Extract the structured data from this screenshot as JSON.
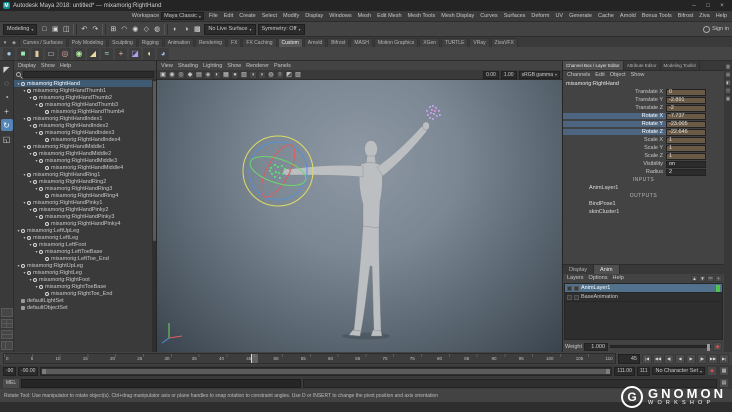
{
  "colors": {
    "selection_highlight": "#3f5a73",
    "keyed_channel": "#6b5a46",
    "active_tool_blue": "#5285b5",
    "manip_x_red": "#e05c5c",
    "manip_y_green": "#6cd66c",
    "manip_z_blue": "#5590d6",
    "manip_outer_yellow": "#dede66",
    "selected_joints_green": "#63e07c",
    "secondary_joints_purple": "#c7a4ea",
    "anim_layer_indicator_green": "#4ec24e"
  },
  "icons": {
    "chevron_down": "▾",
    "window_minimize": "–",
    "window_maximize": "□",
    "window_close": "×",
    "maya_logo_letter": "M",
    "autokey": "◆",
    "prefs_gear": "▦",
    "script_editor": "▤",
    "weight_key": "◆"
  },
  "title_bar": {
    "title": "Autodesk Maya 2018: untitled* --- mixamorig:RightHand"
  },
  "menu_bar": {
    "items": [
      "File",
      "Edit",
      "Create",
      "Select",
      "Modify",
      "Display",
      "Windows",
      "Mesh",
      "Edit Mesh",
      "Mesh Tools",
      "Mesh Display",
      "Curves",
      "Surfaces",
      "Deform",
      "UV",
      "Generate",
      "Cache",
      "Arnold",
      "Bonus Tools",
      "Bifrost",
      "Ziva",
      "Help"
    ],
    "workspace_label": "Workspace",
    "workspace_value": "Maya Classic"
  },
  "status_line": {
    "menu_set": "Modeling",
    "icons": [
      {
        "name": "new-scene-icon",
        "glyph": "□"
      },
      {
        "name": "open-scene-icon",
        "glyph": "▣"
      },
      {
        "name": "save-scene-icon",
        "glyph": "◫"
      },
      {
        "name": "separator",
        "cls": "sep",
        "glyph": ""
      },
      {
        "name": "undo-icon",
        "glyph": "↶"
      },
      {
        "name": "redo-icon",
        "glyph": "↷"
      },
      {
        "name": "separator",
        "cls": "sep",
        "glyph": ""
      },
      {
        "name": "snap-to-grid-icon",
        "glyph": "⊞"
      },
      {
        "name": "snap-to-curve-icon",
        "glyph": "◠"
      },
      {
        "name": "snap-to-point-icon",
        "glyph": "◉"
      },
      {
        "name": "snap-to-plane-icon",
        "glyph": "◇"
      },
      {
        "name": "make-live-icon",
        "glyph": "◍"
      },
      {
        "name": "separator",
        "cls": "sep",
        "glyph": ""
      },
      {
        "name": "render-icon",
        "glyph": "◐"
      },
      {
        "name": "ipr-render-icon",
        "glyph": "◑"
      },
      {
        "name": "render-settings-icon",
        "glyph": "▩"
      }
    ],
    "no_live_surface": "No Live Surface",
    "symmetry": "Symmetry: Off",
    "sign_in": "Sign in"
  },
  "shelf": {
    "tabs": [
      {
        "label": "Curves / Surfaces"
      },
      {
        "label": "Poly Modeling"
      },
      {
        "label": "Sculpting"
      },
      {
        "label": "Rigging"
      },
      {
        "label": "Animation"
      },
      {
        "label": "Rendering"
      },
      {
        "label": "FX"
      },
      {
        "label": "FX Caching"
      },
      {
        "label": "Custom",
        "cls": "active"
      },
      {
        "label": "Arnold"
      },
      {
        "label": "Bifrost"
      },
      {
        "label": "MASH"
      },
      {
        "label": "Motion Graphics"
      },
      {
        "label": "XGen"
      },
      {
        "label": "TURTLE"
      },
      {
        "label": "VRay"
      },
      {
        "label": "ZivaVFX"
      }
    ],
    "icons": [
      {
        "name": "shelf-sphere-icon",
        "glyph": "●",
        "color": "#9ec7e8"
      },
      {
        "name": "shelf-cube-icon",
        "glyph": "■",
        "color": "#9ee8b0"
      },
      {
        "name": "shelf-cylinder-icon",
        "glyph": "▮",
        "color": "#e8c79e"
      },
      {
        "name": "shelf-plane-icon",
        "glyph": "▭",
        "color": "#c7c7c7"
      },
      {
        "name": "shelf-torus-icon",
        "glyph": "◎",
        "color": "#e89e9e"
      },
      {
        "name": "shelf-joint-icon",
        "glyph": "◉",
        "color": "#b0e89e"
      },
      {
        "name": "shelf-ik-handle-icon",
        "glyph": "◢",
        "color": "#e8dc9e"
      },
      {
        "name": "shelf-curve-icon",
        "glyph": "≈",
        "color": "#9ee8e0"
      },
      {
        "name": "shelf-locator-icon",
        "glyph": "+",
        "color": "#e8b09e"
      },
      {
        "name": "shelf-camera-icon",
        "glyph": "◪",
        "color": "#b09ee8"
      },
      {
        "name": "shelf-light-icon",
        "glyph": "◖",
        "color": "#e8e09e"
      },
      {
        "name": "shelf-material-icon",
        "glyph": "◕",
        "color": "#9eb0e8"
      }
    ]
  },
  "toolbox": {
    "tools": [
      {
        "name": "select-tool-button",
        "glyph": "◤"
      },
      {
        "name": "lasso-tool-button",
        "glyph": "◌"
      },
      {
        "name": "paint-select-tool-button",
        "glyph": "◔"
      },
      {
        "name": "move-tool-button",
        "glyph": "+"
      },
      {
        "name": "rotate-tool-button",
        "glyph": "↻",
        "cls": "active"
      },
      {
        "name": "scale-tool-button",
        "glyph": "◱"
      }
    ]
  },
  "outliner": {
    "menus": [
      "Display",
      "Show",
      "Help"
    ],
    "search_value": "",
    "items": [
      {
        "name": "outliner-item-righthand",
        "label": "mixamorig:RightHand",
        "level": 0,
        "cls": "selected",
        "icon": "joint",
        "arrow": "▾"
      },
      {
        "name": "outliner-item",
        "label": "mixamorig:RightHandThumb1",
        "level": 1,
        "icon": "joint",
        "arrow": "▾"
      },
      {
        "name": "outliner-item",
        "label": "mixamorig:RightHandThumb2",
        "level": 2,
        "icon": "joint",
        "arrow": "▾"
      },
      {
        "name": "outliner-item",
        "label": "mixamorig:RightHandThumb3",
        "level": 3,
        "icon": "joint",
        "arrow": "▾"
      },
      {
        "name": "outliner-item",
        "label": "mixamorig:RightHandThumb4",
        "level": 4,
        "icon": "joint",
        "arrow": ""
      },
      {
        "name": "outliner-item",
        "label": "mixamorig:RightHandIndex1",
        "level": 1,
        "icon": "joint",
        "arrow": "▾"
      },
      {
        "name": "outliner-item",
        "label": "mixamorig:RightHandIndex2",
        "level": 2,
        "icon": "joint",
        "arrow": "▾"
      },
      {
        "name": "outliner-item",
        "label": "mixamorig:RightHandIndex3",
        "level": 3,
        "icon": "joint",
        "arrow": "▾"
      },
      {
        "name": "outliner-item",
        "label": "mixamorig:RightHandIndex4",
        "level": 4,
        "icon": "joint",
        "arrow": ""
      },
      {
        "name": "outliner-item",
        "label": "mixamorig:RightHandMiddle1",
        "level": 1,
        "icon": "joint",
        "arrow": "▾"
      },
      {
        "name": "outliner-item",
        "label": "mixamorig:RightHandMiddle2",
        "level": 2,
        "icon": "joint",
        "arrow": "▾"
      },
      {
        "name": "outliner-item",
        "label": "mixamorig:RightHandMiddle3",
        "level": 3,
        "icon": "joint",
        "arrow": "▾"
      },
      {
        "name": "outliner-item",
        "label": "mixamorig:RightHandMiddle4",
        "level": 4,
        "icon": "joint",
        "arrow": ""
      },
      {
        "name": "outliner-item",
        "label": "mixamorig:RightHandRing1",
        "level": 1,
        "icon": "joint",
        "arrow": "▾"
      },
      {
        "name": "outliner-item",
        "label": "mixamorig:RightHandRing2",
        "level": 2,
        "icon": "joint",
        "arrow": "▾"
      },
      {
        "name": "outliner-item",
        "label": "mixamorig:RightHandRing3",
        "level": 3,
        "icon": "joint",
        "arrow": "▾"
      },
      {
        "name": "outliner-item",
        "label": "mixamorig:RightHandRing4",
        "level": 4,
        "icon": "joint",
        "arrow": ""
      },
      {
        "name": "outliner-item",
        "label": "mixamorig:RightHandPinky1",
        "level": 1,
        "icon": "joint",
        "arrow": "▾"
      },
      {
        "name": "outliner-item",
        "label": "mixamorig:RightHandPinky2",
        "level": 2,
        "icon": "joint",
        "arrow": "▾"
      },
      {
        "name": "outliner-item",
        "label": "mixamorig:RightHandPinky3",
        "level": 3,
        "icon": "joint",
        "arrow": "▾"
      },
      {
        "name": "outliner-item",
        "label": "mixamorig:RightHandPinky4",
        "level": 4,
        "icon": "joint",
        "arrow": ""
      },
      {
        "name": "outliner-item",
        "label": "mixamorig:LeftUpLeg",
        "level": 0,
        "icon": "joint",
        "arrow": "▾"
      },
      {
        "name": "outliner-item",
        "label": "mixamorig:LeftLeg",
        "level": 1,
        "icon": "joint",
        "arrow": "▾"
      },
      {
        "name": "outliner-item",
        "label": "mixamorig:LeftFoot",
        "level": 2,
        "icon": "joint",
        "arrow": "▾"
      },
      {
        "name": "outliner-item",
        "label": "mixamorig:LeftToeBase",
        "level": 3,
        "icon": "joint",
        "arrow": "▾"
      },
      {
        "name": "outliner-item",
        "label": "mixamorig:LeftToe_End",
        "level": 4,
        "icon": "joint",
        "arrow": ""
      },
      {
        "name": "outliner-item",
        "label": "mixamorig:RightUpLeg",
        "level": 0,
        "icon": "joint",
        "arrow": "▾"
      },
      {
        "name": "outliner-item",
        "label": "mixamorig:RightLeg",
        "level": 1,
        "icon": "joint",
        "arrow": "▾"
      },
      {
        "name": "outliner-item",
        "label": "mixamorig:RightFoot",
        "level": 2,
        "icon": "joint",
        "arrow": "▾"
      },
      {
        "name": "outliner-item",
        "label": "mixamorig:RightToeBase",
        "level": 3,
        "icon": "joint",
        "arrow": "▾"
      },
      {
        "name": "outliner-item",
        "label": "mixamorig:RightToe_End",
        "level": 4,
        "icon": "joint",
        "arrow": ""
      },
      {
        "name": "outliner-item",
        "label": "defaultLightSet",
        "level": 0,
        "icon": "set",
        "arrow": ""
      },
      {
        "name": "outliner-item",
        "label": "defaultObjectSet",
        "level": 0,
        "icon": "set",
        "arrow": ""
      }
    ]
  },
  "viewport": {
    "menus": [
      "View",
      "Shading",
      "Lighting",
      "Show",
      "Renderer",
      "Panels"
    ],
    "toolbar_icons": [
      {
        "name": "select-camera-icon",
        "glyph": "▣"
      },
      {
        "name": "lock-camera-icon",
        "glyph": "◉"
      },
      {
        "name": "camera-attributes-icon",
        "glyph": "◎"
      },
      {
        "name": "bookmark-icon",
        "glyph": "◆"
      },
      {
        "name": "image-plane-icon",
        "glyph": "▤"
      },
      {
        "name": "two-d-pan-zoom-icon",
        "glyph": "◈"
      },
      {
        "name": "grease-pencil-icon",
        "glyph": "◐"
      },
      {
        "name": "wireframe-icon",
        "glyph": "▦"
      },
      {
        "name": "smooth-shade-icon",
        "glyph": "●"
      },
      {
        "name": "textured-icon",
        "glyph": "▨"
      },
      {
        "name": "use-all-lights-icon",
        "glyph": "◖"
      },
      {
        "name": "shadows-icon",
        "glyph": "◗"
      },
      {
        "name": "ambient-occlusion-icon",
        "glyph": "◍"
      },
      {
        "name": "motion-blur-icon",
        "glyph": "◊"
      },
      {
        "name": "isolate-select-icon",
        "glyph": "◩"
      },
      {
        "name": "xray-icon",
        "glyph": "▧"
      }
    ],
    "toolbar": {
      "exposure": "0.00",
      "gamma": "1.00",
      "color_space": "sRGB gamma"
    }
  },
  "channel_box": {
    "tabs": [
      {
        "label": "Channel Box / Layer Editor",
        "cls": "active"
      },
      {
        "label": "Attribute Editor"
      },
      {
        "label": "Modeling Toolkit"
      }
    ],
    "menus": [
      "Channels",
      "Edit",
      "Object",
      "Show"
    ],
    "object_name": "mixamorig:RightHand",
    "channels": [
      {
        "name": "Translate X",
        "value": "0",
        "value_cls": "keyed"
      },
      {
        "name": "Translate Y",
        "value": "-2.891",
        "value_cls": "keyed"
      },
      {
        "name": "Translate Z",
        "value": "-2",
        "value_cls": "keyed"
      },
      {
        "name": "Rotate X",
        "value": "-7.737",
        "label_cls": "sel",
        "value_cls": "keyed"
      },
      {
        "name": "Rotate Y",
        "value": "-23.005",
        "label_cls": "sel",
        "value_cls": "keyed"
      },
      {
        "name": "Rotate Z",
        "value": "-22.646",
        "label_cls": "sel",
        "value_cls": "keyed"
      },
      {
        "name": "Scale X",
        "value": "1",
        "value_cls": "keyed"
      },
      {
        "name": "Scale Y",
        "value": "1",
        "value_cls": "keyed"
      },
      {
        "name": "Scale Z",
        "value": "1",
        "value_cls": "keyed"
      },
      {
        "name": "Visibility",
        "value": "on"
      },
      {
        "name": "Radius",
        "value": "2"
      }
    ],
    "inputs_label": "INPUTS",
    "inputs": [
      "AnimLayer1"
    ],
    "outputs_label": "OUTPUTS",
    "outputs": [
      "BindPose1",
      "skinCluster1"
    ]
  },
  "layer_editor": {
    "tabs": [
      {
        "label": "Display"
      },
      {
        "label": "Anim",
        "cls": "active"
      }
    ],
    "menus": [
      "Layers",
      "Options",
      "Help"
    ],
    "mini_icons": [
      {
        "name": "layer-up-icon",
        "glyph": "▲"
      },
      {
        "name": "layer-down-icon",
        "glyph": "▼"
      },
      {
        "name": "empty-layer-icon",
        "glyph": "▭"
      },
      {
        "name": "new-layer-icon",
        "glyph": "+"
      }
    ],
    "layers": [
      {
        "name": "anim-layer-row",
        "label": "AnimLayer1",
        "cls": "selected",
        "ind": "on"
      },
      {
        "name": "base-animation-row",
        "label": "BaseAnimation",
        "cls": "",
        "ind": ""
      }
    ],
    "weight_label": "Weight",
    "weight_value": "1.000"
  },
  "right_strip_icons": [
    {
      "name": "channel-box-toggle-icon",
      "glyph": "▥"
    },
    {
      "name": "attribute-editor-toggle-icon",
      "glyph": "▤"
    },
    {
      "name": "tool-settings-toggle-icon",
      "glyph": "◧"
    },
    {
      "name": "channel-slider-mode-icon",
      "glyph": "◫"
    },
    {
      "name": "hyperbolic-mode-icon",
      "glyph": "▦"
    }
  ],
  "time_slider": {
    "ticks": [
      "0",
      "5",
      "10",
      "15",
      "20",
      "25",
      "30",
      "35",
      "40",
      "45",
      "50",
      "55",
      "60",
      "65",
      "70",
      "75",
      "80",
      "85",
      "90",
      "95",
      "100",
      "105",
      "110"
    ],
    "current_frame": "45",
    "transport": [
      {
        "name": "go-to-start-button",
        "glyph": "|◀"
      },
      {
        "name": "step-back-key-button",
        "glyph": "◀◀"
      },
      {
        "name": "step-back-frame-button",
        "glyph": "◀|"
      },
      {
        "name": "play-backwards-button",
        "glyph": "◀"
      },
      {
        "name": "play-forwards-button",
        "glyph": "▶"
      },
      {
        "name": "step-forward-frame-button",
        "glyph": "|▶"
      },
      {
        "name": "step-forward-key-button",
        "glyph": "▶▶"
      },
      {
        "name": "go-to-end-button",
        "glyph": "▶|"
      }
    ]
  },
  "range_slider": {
    "anim_start": "-90",
    "playback_start": "-90.00",
    "playback_end": "111.00",
    "anim_end": "111",
    "character_set": "No Character Set"
  },
  "command_line": {
    "label": "MEL",
    "input_value": ""
  },
  "help_line": {
    "text": "Rotate Tool: Use manipulator to rotate object(s). Ctrl+drag manipulator axis or plane handles to snap rotation to constraint angles. Use D or INSERT to change the pivot position and axis orientation"
  },
  "watermark": {
    "logo_letter": "G",
    "line1": "GNOMON",
    "line2": "WORKSHOP"
  }
}
